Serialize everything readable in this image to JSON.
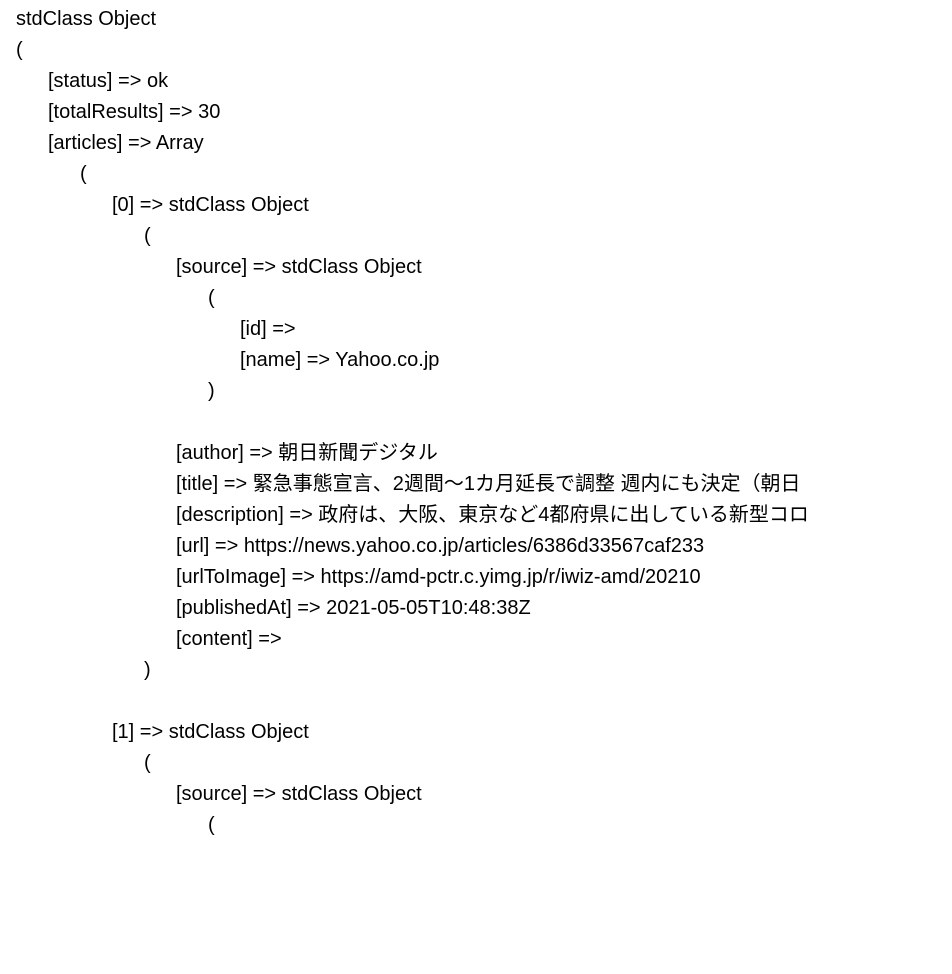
{
  "t": {
    "root": "stdClass Object",
    "open": "(",
    "close": ")",
    "status": "[status] => ok",
    "totalResults": "[totalResults] => 30",
    "articles": "[articles] => Array",
    "idx0": "[0] => stdClass Object",
    "source": "[source] => stdClass Object",
    "srcId": "[id] =>",
    "srcName": "[name] => Yahoo.co.jp",
    "author": "[author] => 朝日新聞デジタル",
    "title": "[title] => 緊急事態宣言、2週間～1カ月延長で調整 週内にも決定（朝日",
    "description": "[description] => 政府は、大阪、東京など4都府県に出している新型コロ",
    "url": "[url] => https://news.yahoo.co.jp/articles/6386d33567caf233",
    "urlToImage": "[urlToImage] => https://amd-pctr.c.yimg.jp/r/iwiz-amd/20210",
    "publishedAt": "[publishedAt] => 2021-05-05T10:48:38Z",
    "content": "[content] =>",
    "idx1": "[1] => stdClass Object"
  }
}
